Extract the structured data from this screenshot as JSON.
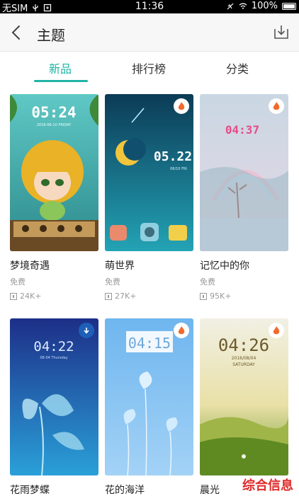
{
  "status_bar": {
    "carrier": "无SIM",
    "time": "11:36",
    "battery": "100%"
  },
  "header": {
    "title": "主题"
  },
  "tabs": [
    {
      "label": "新品",
      "active": true
    },
    {
      "label": "排行榜",
      "active": false
    },
    {
      "label": "分类",
      "active": false
    }
  ],
  "accent_color": "#1fb4a5",
  "themes": [
    {
      "name": "梦境奇遇",
      "price": "免费",
      "downloads": "24K+",
      "clock": "05:24",
      "clock_date": "2016-06-10  FRIDAY",
      "badge": "none"
    },
    {
      "name": "萌世界",
      "price": "免费",
      "downloads": "27K+",
      "clock": "05.22",
      "clock_date": "06/10 FRI",
      "badge": "flame"
    },
    {
      "name": "记忆中的你",
      "price": "免费",
      "downloads": "95K+",
      "clock": "04:37",
      "badge": "flame"
    },
    {
      "name": "花雨梦蝶",
      "clock": "04:22",
      "clock_date": "08-04  Thursday",
      "badge": "download"
    },
    {
      "name": "花的海洋",
      "clock": "04:15",
      "badge": "flame"
    },
    {
      "name": "晨光",
      "clock": "04:26",
      "clock_date": "2016/08/04",
      "clock_day": "SATURDAY",
      "badge": "flame"
    }
  ],
  "watermark": "综合信息"
}
